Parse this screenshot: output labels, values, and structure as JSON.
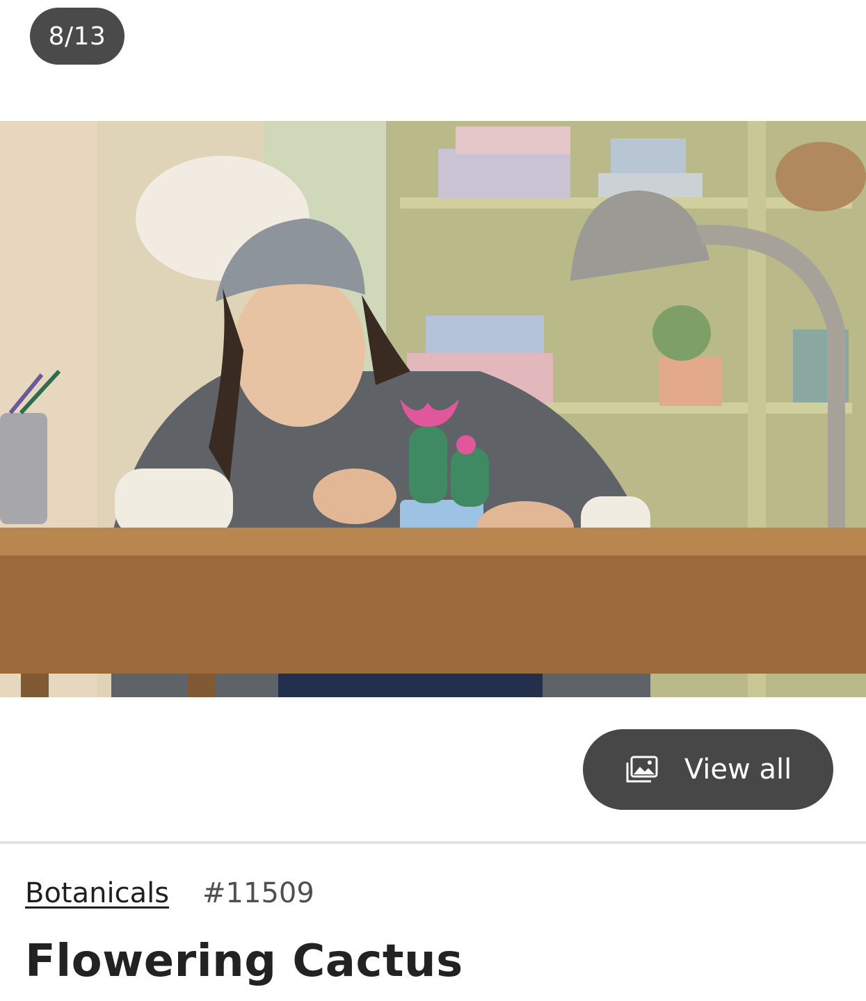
{
  "gallery": {
    "counter": "8/13",
    "view_all_label": "View all",
    "view_all_icon": "gallery-icon"
  },
  "product": {
    "category": "Botanicals",
    "item_number": "#11509",
    "title": "Flowering Cactus"
  },
  "colors": {
    "pill_background": "#474747",
    "divider": "#e2e2e2",
    "text": "#1f1f1f"
  }
}
